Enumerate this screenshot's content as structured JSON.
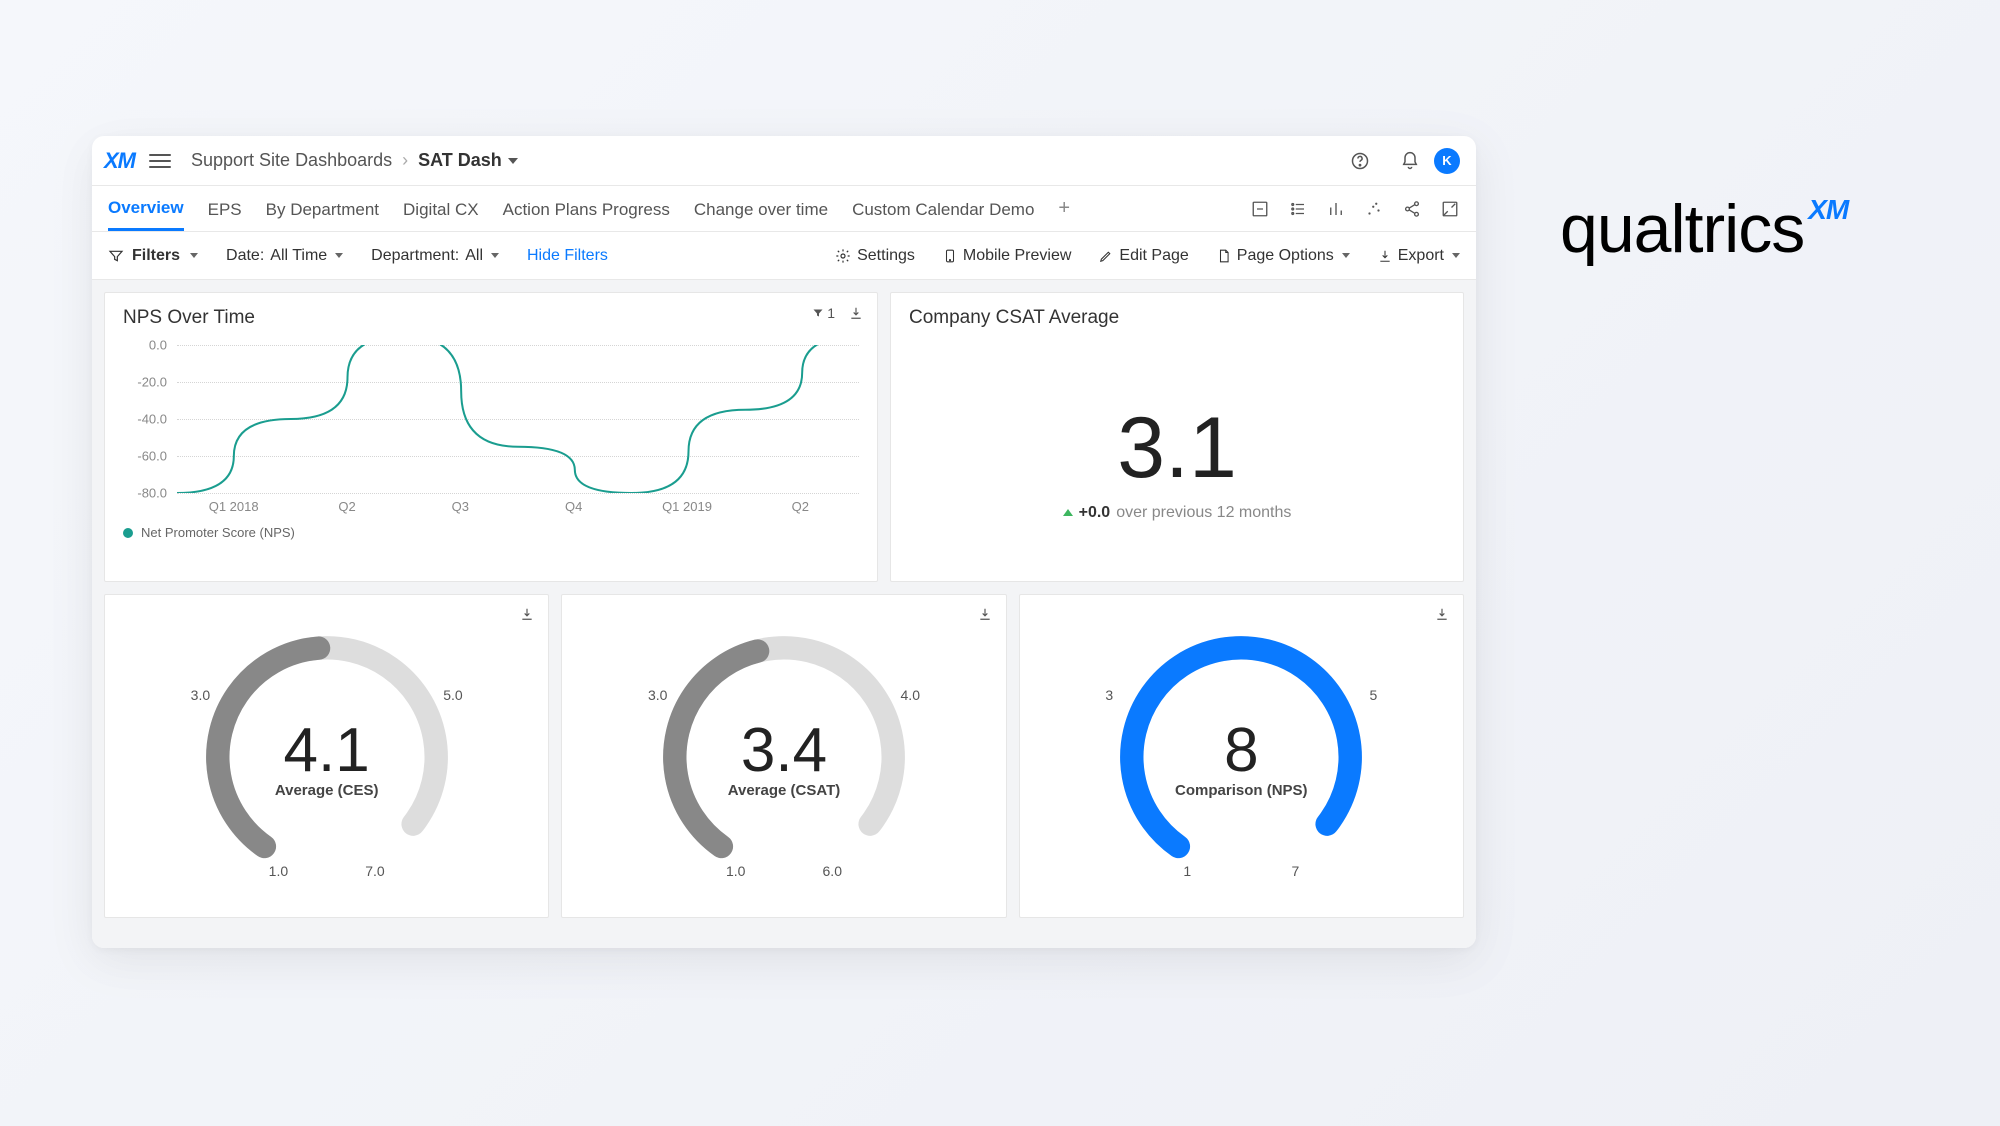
{
  "external_brand": {
    "name": "qualtrics",
    "suffix": "XM"
  },
  "header": {
    "logo": "XM",
    "breadcrumb_parent": "Support Site Dashboards",
    "breadcrumb_current": "SAT Dash",
    "avatar_initial": "K"
  },
  "tabs": [
    {
      "label": "Overview",
      "active": true
    },
    {
      "label": "EPS"
    },
    {
      "label": "By Department"
    },
    {
      "label": "Digital CX"
    },
    {
      "label": "Action Plans Progress"
    },
    {
      "label": "Change over time"
    },
    {
      "label": "Custom Calendar Demo"
    }
  ],
  "toolbar": {
    "filters_label": "Filters",
    "date_label": "Date:",
    "date_value": "All Time",
    "department_label": "Department:",
    "department_value": "All",
    "hide_filters": "Hide Filters",
    "settings": "Settings",
    "mobile_preview": "Mobile Preview",
    "edit_page": "Edit Page",
    "page_options": "Page Options",
    "export": "Export"
  },
  "cards": {
    "nps": {
      "title": "NPS Over Time",
      "filter_count": "1",
      "legend": "Net Promoter Score (NPS)"
    },
    "csat": {
      "title": "Company CSAT Average",
      "value": "3.1",
      "delta": "+0.0",
      "delta_period": "over previous 12 months"
    },
    "gauge_ces": {
      "value": "4.1",
      "label": "Average (CES)",
      "min": "1.0",
      "max": "7.0",
      "left": "3.0",
      "right": "5.0"
    },
    "gauge_csat": {
      "value": "3.4",
      "label": "Average (CSAT)",
      "min": "1.0",
      "max": "6.0",
      "left": "3.0",
      "right": "4.0"
    },
    "gauge_nps": {
      "value": "8",
      "label": "Comparison (NPS)",
      "min": "1",
      "max": "7",
      "left": "3",
      "right": "5"
    }
  },
  "chart_data": {
    "type": "line",
    "title": "NPS Over Time",
    "series_name": "Net Promoter Score (NPS)",
    "categories": [
      "Q1 2018",
      "Q2",
      "Q3",
      "Q4",
      "Q1 2019",
      "Q2"
    ],
    "values": [
      -80,
      -40,
      5,
      -55,
      -80,
      -35,
      5
    ],
    "ylabel": "",
    "xlabel": "",
    "ylim": [
      -80,
      0
    ],
    "yticks": [
      0,
      -20,
      -40,
      -60,
      -80
    ],
    "xticks": [
      "Q1 2018",
      "Q2",
      "Q3",
      "Q4",
      "Q1 2019",
      "Q2"
    ]
  }
}
